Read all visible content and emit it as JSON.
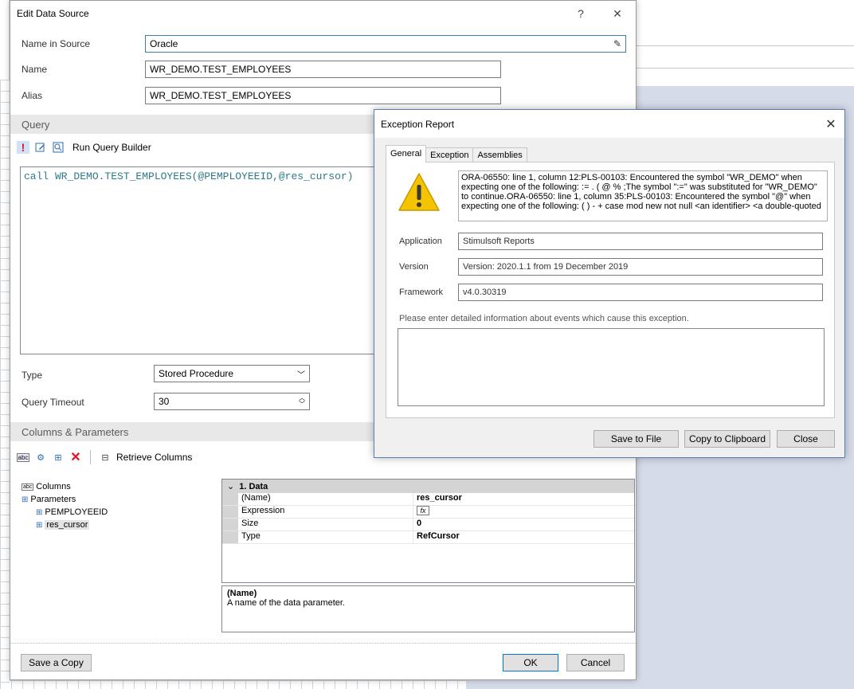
{
  "main_dialog": {
    "title": "Edit Data Source",
    "help_glyph": "?",
    "close_glyph": "✕",
    "fields": {
      "name_in_source_label": "Name in Source",
      "name_in_source_value": "Oracle",
      "name_label": "Name",
      "name_value": "WR_DEMO.TEST_EMPLOYEES",
      "alias_label": "Alias",
      "alias_value": "WR_DEMO.TEST_EMPLOYEES"
    },
    "query": {
      "header": "Query",
      "run_query_builder_label": "Run Query Builder",
      "text": "call WR_DEMO.TEST_EMPLOYEES(@PEMPLOYEEID,@res_cursor)",
      "type_label": "Type",
      "type_value": "Stored Procedure",
      "timeout_label": "Query Timeout",
      "timeout_value": "30"
    },
    "columns_params": {
      "header": "Columns & Parameters",
      "retrieve_columns_label": "Retrieve Columns",
      "tree": {
        "columns": "Columns",
        "parameters": "Parameters",
        "param1": "PEMPLOYEEID",
        "param2": "res_cursor"
      },
      "properties": {
        "category": "1. Data",
        "rows": [
          {
            "key": "(Name)",
            "value": "res_cursor"
          },
          {
            "key": "Expression",
            "value": ""
          },
          {
            "key": "Size",
            "value": "0"
          },
          {
            "key": "Type",
            "value": "RefCursor"
          }
        ]
      },
      "description_title": "(Name)",
      "description_text": "A name of the data parameter."
    },
    "buttons": {
      "save_copy": "Save a Copy",
      "ok": "OK",
      "cancel": "Cancel"
    }
  },
  "exception_dialog": {
    "title": "Exception Report",
    "close_glyph": "✕",
    "tabs": [
      "General",
      "Exception",
      "Assemblies"
    ],
    "message": "ORA-06550: line 1, column 12:PLS-00103: Encountered the symbol \"WR_DEMO\" when expecting one of the following:   := . ( @ % ;The symbol \":=\" was substituted for \"WR_DEMO\" to continue.ORA-06550: line 1, column 35:PLS-00103: Encountered the symbol \"@\" when expecting one of the following:   ( ) - + case mod new not null <an identifier>   <a double-quoted",
    "application_label": "Application",
    "application_value": "Stimulsoft Reports",
    "version_label": "Version",
    "version_value": "Version: 2020.1.1 from 19 December 2019",
    "framework_label": "Framework",
    "framework_value": "v4.0.30319",
    "hint": "Please enter detailed information about events which cause this exception.",
    "buttons": {
      "save_to_file": "Save to File",
      "copy_to_clipboard": "Copy to Clipboard",
      "close": "Close"
    }
  },
  "colors": {
    "accent": "#0078d7",
    "error_icon": "#e81123",
    "warning_yellow": "#f5c400",
    "code_text": "#2d7a8a"
  }
}
